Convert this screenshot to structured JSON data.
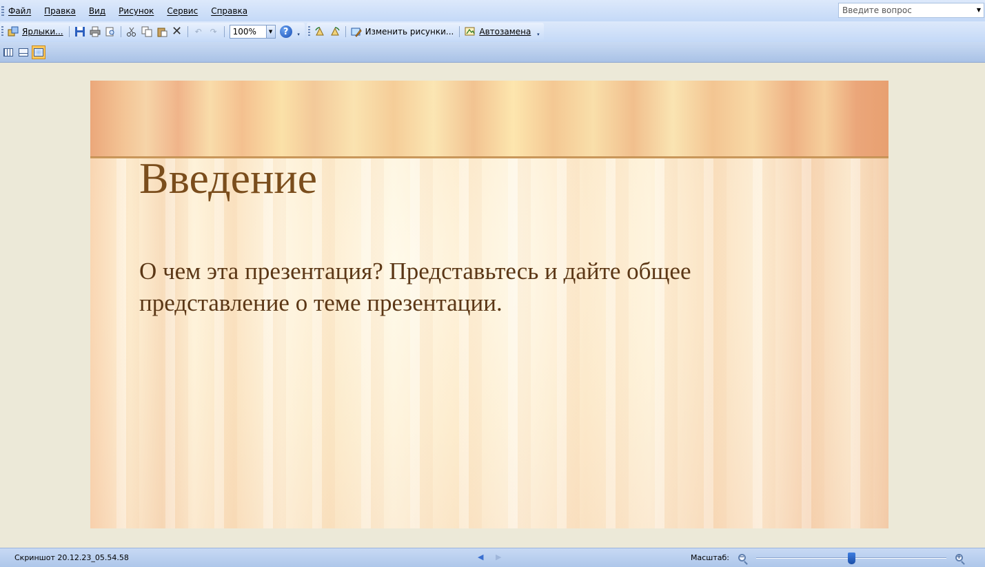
{
  "menu": {
    "items": [
      "Файл",
      "Правка",
      "Вид",
      "Рисунок",
      "Сервис",
      "Справка"
    ],
    "ask_placeholder": "Введите вопрос"
  },
  "toolbar": {
    "shortcuts_label": "Ярлыки...",
    "zoom_value": "100%",
    "edit_pictures_label": "Изменить рисунки...",
    "autocorrect_label": "Автозамена"
  },
  "view_modes": {
    "active": "slide-view"
  },
  "slide": {
    "title": "Введение",
    "body": "О чем эта презентация? Представьтесь и дайте общее представление о теме презентации."
  },
  "status": {
    "filename": "Скриншот 20.12.23_05.54.58",
    "zoom_label": "Масштаб:",
    "zoom_level_fraction": 0.5
  },
  "colors": {
    "title_color": "#7a4d1c",
    "body_color": "#5b3716",
    "toolbar_blue": "#c4d9f7",
    "active_view": "#ffc85a"
  }
}
